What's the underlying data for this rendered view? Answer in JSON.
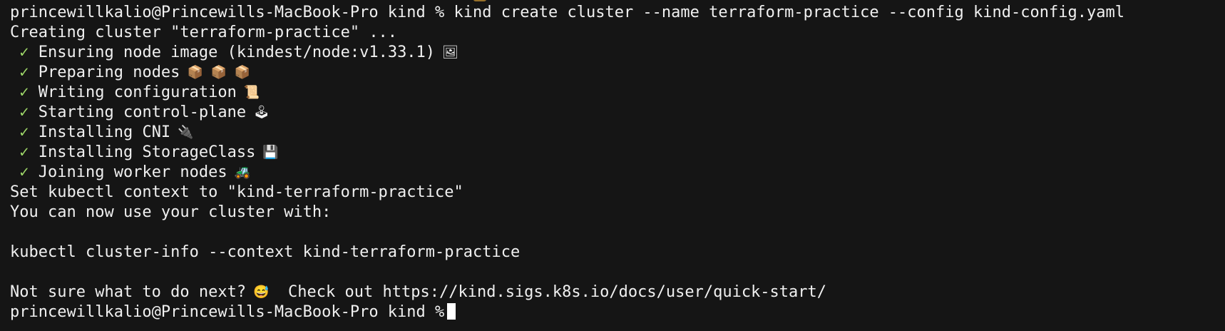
{
  "terminal": {
    "prompt": "princewillkalio@Princewills-MacBook-Pro kind %",
    "command": "kind create cluster --name terraform-practice --config kind-config.yaml",
    "creating": "Creating cluster \"terraform-practice\" ...",
    "check_symbol": " ✓ ",
    "steps": [
      {
        "label": "Ensuring node image (kindest/node:v1.33.1)",
        "icon": "framed-picture-icon",
        "emoji": "🖼"
      },
      {
        "label": "Preparing nodes",
        "icon": "package-icon",
        "emoji": "📦 📦 📦"
      },
      {
        "label": "Writing configuration",
        "icon": "scroll-icon",
        "emoji": "📜"
      },
      {
        "label": "Starting control-plane",
        "icon": "joystick-icon",
        "emoji": "🕹"
      },
      {
        "label": "Installing CNI",
        "icon": "plug-icon",
        "emoji": "🔌"
      },
      {
        "label": "Installing StorageClass",
        "icon": "floppy-disk-icon",
        "emoji": "💾"
      },
      {
        "label": "Joining worker nodes",
        "icon": "tractor-icon",
        "emoji": "🚜"
      }
    ],
    "set_context": "Set kubectl context to \"kind-terraform-practice\"",
    "use_cluster": "You can now use your cluster with:",
    "cluster_info_cmd": "kubectl cluster-info --context kind-terraform-practice",
    "not_sure": "Not sure what to do next?",
    "not_sure_emoji": "😅",
    "check_out": "  Check out https://kind.sigs.k8s.io/docs/user/quick-start/",
    "final_prompt": "princewillkalio@Princewills-MacBook-Pro kind %"
  },
  "colors": {
    "background": "#151515",
    "text": "#f0f0f0",
    "check": "#9fd86a",
    "cursor": "#ffffff"
  }
}
